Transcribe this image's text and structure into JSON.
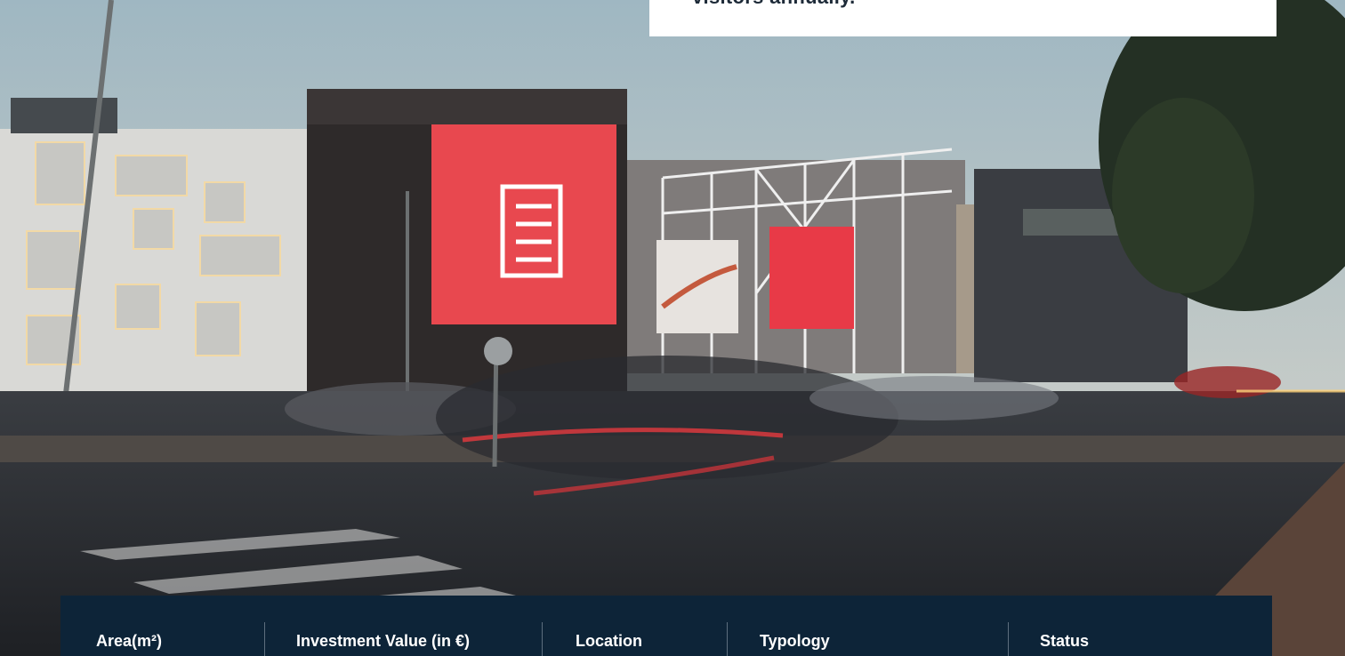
{
  "hero": {
    "image": "shopping-center-night-street",
    "card_text": "visitors annually."
  },
  "stats_bar": {
    "background": "#0d2438",
    "items": [
      {
        "label": "Area(m²)"
      },
      {
        "label": "Investment Value (in €)"
      },
      {
        "label": "Location"
      },
      {
        "label": "Typology"
      },
      {
        "label": "Status"
      }
    ]
  }
}
